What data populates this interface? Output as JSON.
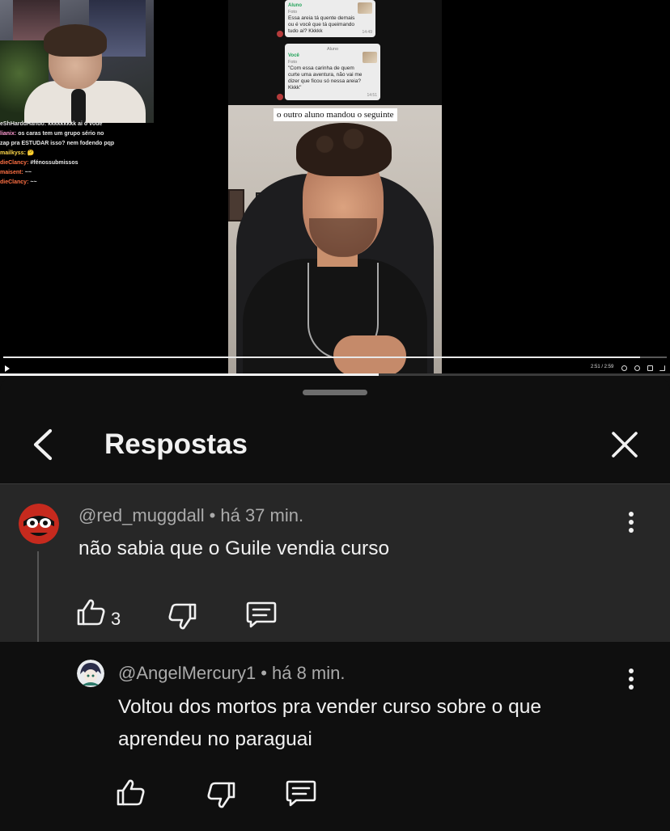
{
  "video": {
    "chat_lines": [
      {
        "user": "",
        "text": "eShHarduHando: kkkkkkkkk ai o voue"
      },
      {
        "user": "lianix:",
        "text": "os caras tem um grupo sério no"
      },
      {
        "user": "",
        "text": "zap pra ESTUDAR isso? nem fodendo pqp"
      },
      {
        "user": "mailkyss:",
        "text": "🤔"
      },
      {
        "user": "dieClancy:",
        "text": "#fénossubmissos"
      },
      {
        "user": "maisent:",
        "text": "~~"
      },
      {
        "user": "dieClancy:",
        "text": "~~"
      }
    ],
    "screenshot_chat": {
      "msg1_sender": "Aluno",
      "msg1_photo": "Foto",
      "msg1_text": "Essa areia tá quente demais ou é você que tá queimando tudo aí? Kkkkk",
      "msg1_time": "14:49",
      "msg2_header": "Aluno",
      "msg2_sender": "Você",
      "msg2_photo": "Foto",
      "msg2_text": "\"Com essa carinha de quem curte uma aventura, não vai me dizer que ficou só nessa areia? Kkkk\"",
      "msg2_time": "14:51"
    },
    "caption": "o outro aluno mandou o seguinte",
    "time": "2:51 / 2:59",
    "progress": 0.96,
    "app_progress": 0.565
  },
  "panel": {
    "title": "Respostas"
  },
  "comments": {
    "parent": {
      "author": "@red_muggdall",
      "time": "há 37 min.",
      "text": "não sabia que o Guile vendia curso",
      "likes": "3"
    },
    "reply": {
      "author": "@AngelMercury1",
      "time": "há 8 min.",
      "text_line1": "Voltou dos mortos pra vender curso sobre o que",
      "text_line2": "aprendeu no paraguai"
    }
  },
  "colors": {
    "background": "#0f0f0f",
    "highlight": "#272727",
    "text": "#f1f1f1",
    "meta": "#aaaaaa"
  },
  "icons": [
    "play-icon",
    "back-arrow-icon",
    "close-icon",
    "more-vert-icon",
    "thumbs-up-icon",
    "thumbs-down-icon",
    "reply-icon"
  ]
}
